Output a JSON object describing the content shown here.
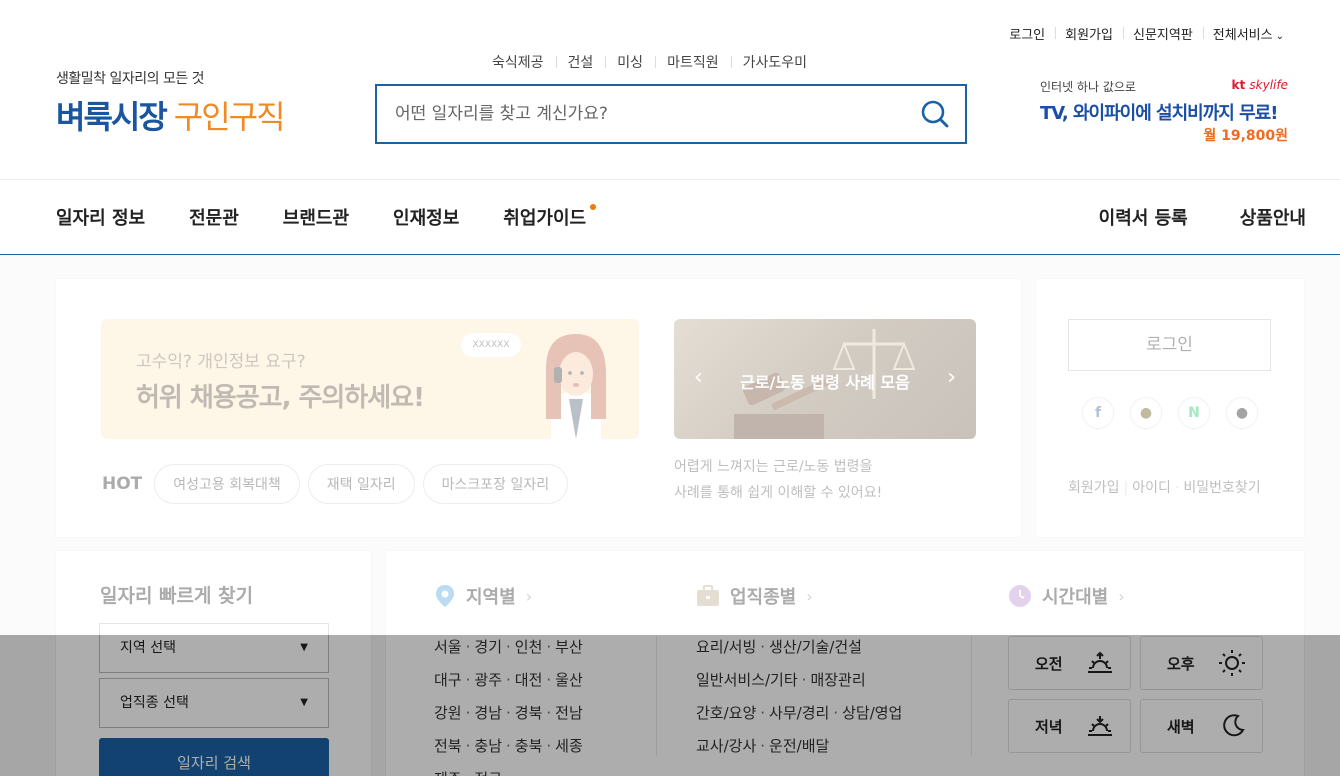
{
  "header": {
    "top_links": [
      "로그인",
      "회원가입",
      "신문지역판",
      "전체서비스"
    ],
    "logo_tagline": "생활밀착 일자리의 모든 것",
    "logo_name_a": "벼룩시장",
    "logo_name_b": "구인구직",
    "quick_keywords": [
      "숙식제공",
      "건설",
      "미싱",
      "마트직원",
      "가사도우미"
    ],
    "search_placeholder": "어떤 일자리를 찾고 계신가요?",
    "ad": {
      "line1": "인터넷 하나 값으로",
      "brand_kt": "kt",
      "brand_skylife": "skylife",
      "line2": "TV, 와이파이에 설치비까지 무료!",
      "price": "월 19,800원"
    }
  },
  "gnb": {
    "left": [
      "일자리 정보",
      "전문관",
      "브랜드관",
      "인재정보",
      "취업가이드"
    ],
    "right": [
      "이력서 등록",
      "상품안내"
    ]
  },
  "main": {
    "banner1": {
      "line1": "고수익? 개인정보 요구?",
      "line2": "허위 채용공고, 주의하세요!",
      "bubble": "XXXXXX"
    },
    "hot_label": "HOT",
    "hot_tags": [
      "여성고용 회복대책",
      "재택 일자리",
      "마스크포장 일자리"
    ],
    "banner2": {
      "title": "근로/노동 법령 사례 모음",
      "desc1": "어렵게 느껴지는 근로/노동 법령을",
      "desc2": "사례를 통해 쉽게 이해할 수 있어요!"
    }
  },
  "login": {
    "button": "로그인",
    "links": [
      "회원가입",
      "아이디",
      "비밀번호찾기"
    ]
  },
  "quick_find": {
    "title": "일자리 빠르게 찾기",
    "region_select": "지역 선택",
    "job_select": "업직종 선택",
    "search_button": "일자리 검색"
  },
  "categories": {
    "region": {
      "title": "지역별",
      "rows": [
        [
          "서울",
          "경기",
          "인천",
          "부산"
        ],
        [
          "대구",
          "광주",
          "대전",
          "울산"
        ],
        [
          "강원",
          "경남",
          "경북",
          "전남"
        ],
        [
          "전북",
          "충남",
          "충북",
          "세종"
        ],
        [
          "제주",
          "전국"
        ]
      ]
    },
    "job": {
      "title": "업직종별",
      "rows": [
        [
          "요리/서빙",
          "생산/기술/건설"
        ],
        [
          "일반서비스/기타",
          "매장관리"
        ],
        [
          "간호/요양",
          "사무/경리",
          "상담/영업"
        ],
        [
          "교사/강사",
          "운전/배달"
        ]
      ]
    },
    "time": {
      "title": "시간대별",
      "items": [
        "오전",
        "오후",
        "저녁",
        "새벽"
      ]
    }
  },
  "colors": {
    "brand_blue": "#1a56a0",
    "brand_orange": "#f08a24",
    "accent_dot": "#f07b0b"
  }
}
